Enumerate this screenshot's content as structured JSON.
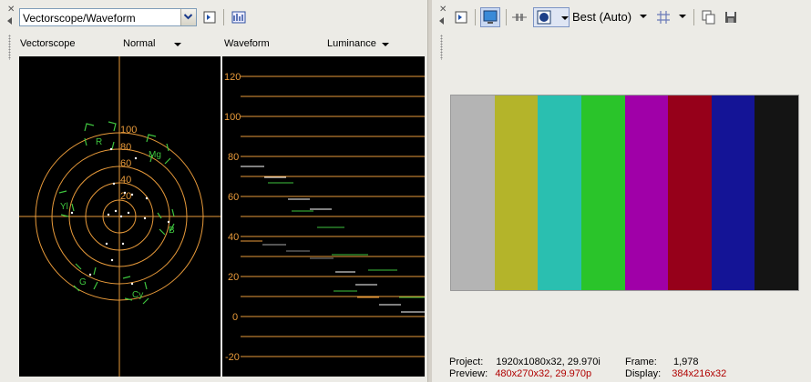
{
  "left_toolbar": {
    "monitor_select": "Vectorscope/Waveform"
  },
  "vectorscope": {
    "title": "Vectorscope",
    "mode": "Normal",
    "rings": [
      "100",
      "80",
      "60",
      "40",
      "20"
    ],
    "targets": [
      "R",
      "Mg",
      "B",
      "Cy",
      "G",
      "Yl"
    ]
  },
  "waveform": {
    "title": "Waveform",
    "mode": "Luminance",
    "scale": [
      120,
      100,
      80,
      60,
      40,
      20,
      0,
      -20
    ]
  },
  "right_toolbar": {
    "quality": "Best (Auto)"
  },
  "color_bars": [
    "#b4b4b4",
    "#b4b42a",
    "#2abfb0",
    "#2ac42a",
    "#a000a8",
    "#96001a",
    "#141496",
    "#141414"
  ],
  "status": {
    "project_label": "Project:",
    "project_value": "1920x1080x32, 29.970i",
    "preview_label": "Preview:",
    "preview_value": "480x270x32, 29.970p",
    "frame_label": "Frame:",
    "frame_value": "1,978",
    "display_label": "Display:",
    "display_value": "384x216x32"
  }
}
